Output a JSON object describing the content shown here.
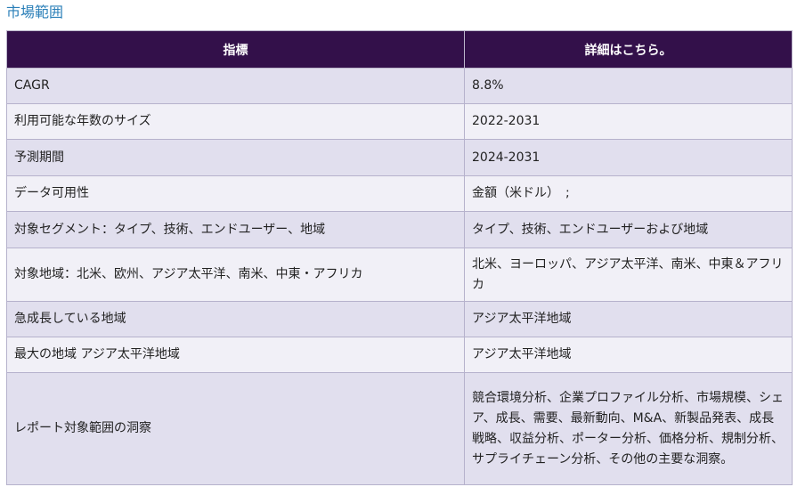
{
  "section_title": "市場範囲",
  "table": {
    "headers": [
      "指標",
      "詳細はこちら。"
    ],
    "rows": [
      {
        "metric": "CAGR",
        "detail": "8.8%"
      },
      {
        "metric": "利用可能な年数のサイズ",
        "detail": "2022-2031"
      },
      {
        "metric": "予測期間",
        "detail": "2024-2031"
      },
      {
        "metric": "データ可用性",
        "detail": "金額（米ドル）　;"
      },
      {
        "metric": "対象セグメント：タイプ、技術、エンドユーザー、地域",
        "detail": "タイプ、技術、エンドユーザーおよび地域"
      },
      {
        "metric": "対象地域：北米、欧州、アジア太平洋、南米、中東・アフリカ",
        "detail": "北米、ヨーロッパ、アジア太平洋、南米、中東＆アフリカ"
      },
      {
        "metric": "急成長している地域",
        "detail": "アジア太平洋地域"
      },
      {
        "metric": "最大の地域 アジア太平洋地域",
        "detail": "アジア太平洋地域"
      },
      {
        "metric": "レポート対象範囲の洞察",
        "detail": "競合環境分析、企業プロファイル分析、市場規模、シェア、成長、需要、最新動向、M&A、新製品発表、成長戦略、収益分析、ポーター分析、価格分析、規制分析、サプライチェーン分析、その他の主要な洞察。"
      }
    ]
  }
}
